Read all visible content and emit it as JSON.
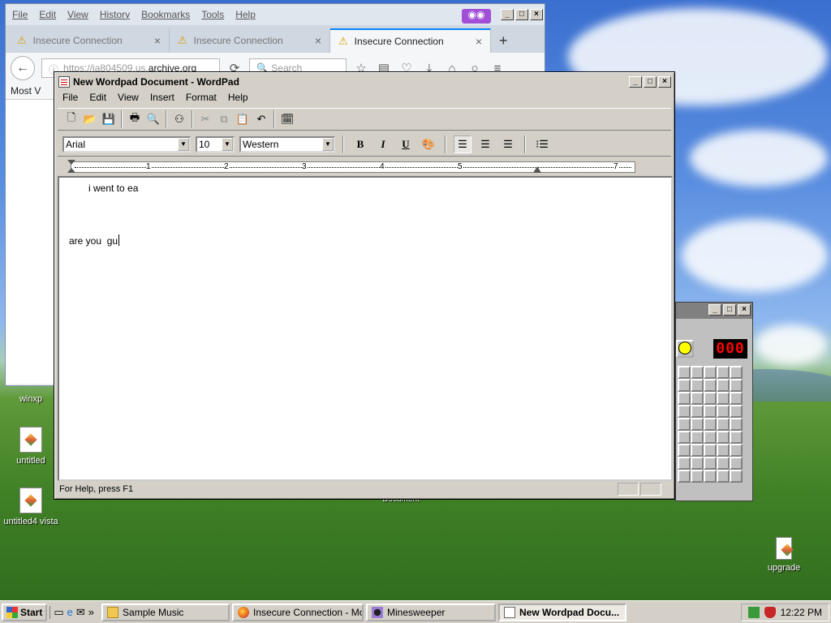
{
  "desktop": {
    "icons": [
      {
        "label": "winxp"
      },
      {
        "label": "untitled"
      },
      {
        "label": "untitled4 vista"
      },
      {
        "label": "upgrade"
      }
    ],
    "obscured_label": "Document"
  },
  "firefox": {
    "menu": [
      "File",
      "Edit",
      "View",
      "History",
      "Bookmarks",
      "Tools",
      "Help"
    ],
    "tabs": [
      {
        "title": "Insecure Connection"
      },
      {
        "title": "Insecure Connection"
      },
      {
        "title": "Insecure Connection",
        "active": true
      }
    ],
    "url_prefix": "https://ia804509.us.",
    "url_domain": "archive.org",
    "search_placeholder": "Search",
    "bookmarks_label": "Most V"
  },
  "minesweeper": {
    "counter": "000"
  },
  "wordpad": {
    "title": "New Wordpad Document - WordPad",
    "menu": [
      "File",
      "Edit",
      "View",
      "Insert",
      "Format",
      "Help"
    ],
    "font": "Arial",
    "size": "10",
    "script": "Western",
    "ruler_numbers": [
      "1",
      "2",
      "3",
      "4",
      "5",
      "7"
    ],
    "document": {
      "line1": "i went to ea",
      "line2": "are you  gu"
    },
    "status": "For Help, press F1",
    "colors": {
      "accent": "#0a84ff",
      "warning": "#d7a100"
    }
  },
  "taskbar": {
    "start_label": "Start",
    "tasks": [
      {
        "label": "Sample Music"
      },
      {
        "label": "Insecure Connection - Mo..."
      },
      {
        "label": "Minesweeper"
      },
      {
        "label": "New Wordpad Docu..."
      }
    ],
    "clock": "12:22 PM"
  }
}
